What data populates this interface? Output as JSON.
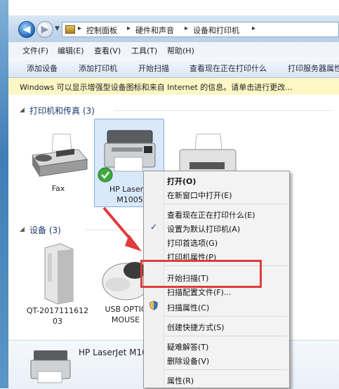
{
  "address_bar": {
    "crumbs": [
      "控制面板",
      "硬件和声音",
      "设备和打印机"
    ]
  },
  "menubar": {
    "items": [
      "文件(F)",
      "编辑(E)",
      "查看(V)",
      "工具(T)",
      "帮助(H)"
    ]
  },
  "toolbar": {
    "items": [
      "添加设备",
      "添加打印机",
      "开始扫描",
      "查看现在正在打印什么",
      "打印服务器属性"
    ]
  },
  "infobar": {
    "text": "Windows 可以显示增强型设备图标和来自 Internet 的信息。请单击进行更改..."
  },
  "groups": {
    "printers": {
      "header": "打印机和传真 (3)"
    },
    "devices": {
      "header": "设备 (3)"
    }
  },
  "devices": {
    "fax": {
      "label": "Fax"
    },
    "hp_printer": {
      "label_line1": "HP LaserJe",
      "label_line2": "M1005"
    },
    "computer": {
      "label_line1": "QT-2017111612",
      "label_line2": "03"
    },
    "mouse": {
      "label_line1": "USB OPTIC",
      "label_line2": "MOUSE"
    }
  },
  "bottom_pane": {
    "device_name": "HP LaserJet M10"
  },
  "context_menu": {
    "items": {
      "open": "打开(O)",
      "open_new_window": "在新窗口中打开(E)",
      "see_printing": "查看现在正在打印什么(E)",
      "set_default": "设置为默认打印机(A)",
      "printing_prefs": "打印首选项(G)",
      "printer_props": "打印机属性(P)",
      "start_scan": "开始扫描(T)",
      "scan_profiles": "扫描配置文件(F)...",
      "scan_props": "扫描属性(C)",
      "create_shortcut": "创建快捷方式(S)",
      "troubleshoot": "疑难解答(T)",
      "remove_device": "删除设备(V)",
      "properties": "属性(R)"
    }
  },
  "colors": {
    "highlight_box": "#e13b3b",
    "arrow": "#e13b3b",
    "selection": "#d9e8fb",
    "group_header": "#1e3a6e"
  }
}
